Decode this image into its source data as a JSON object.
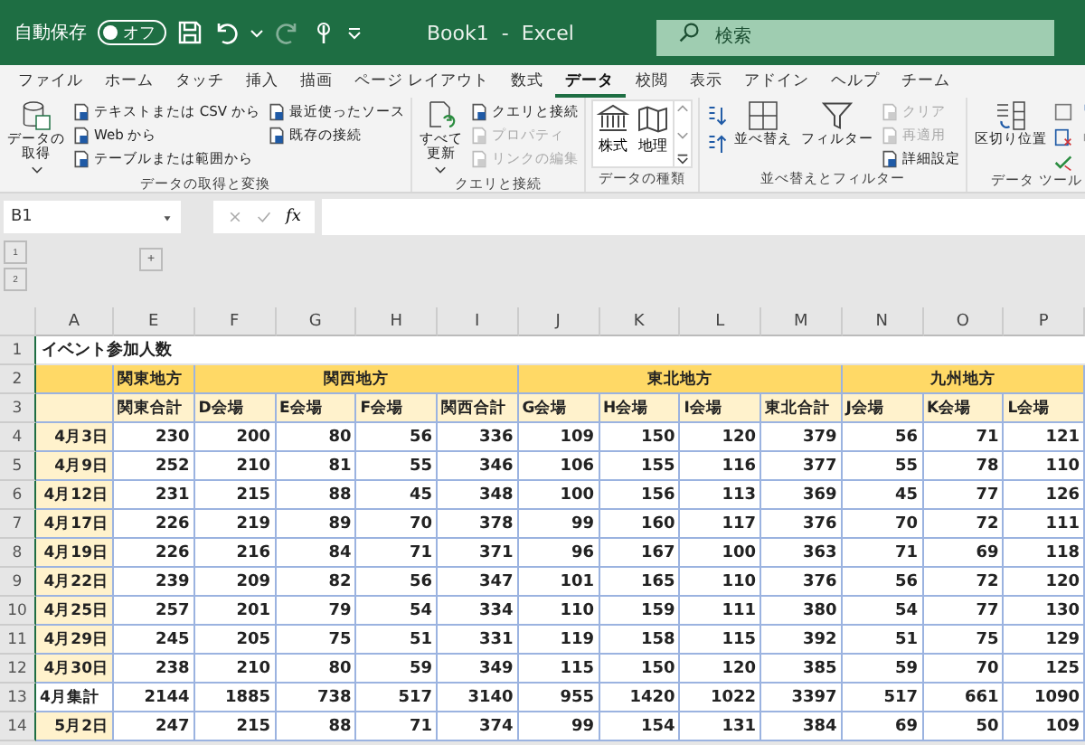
{
  "title_bar": {
    "autosave_label": "自動保存",
    "autosave_toggle": {
      "label": "オフ",
      "on": false
    },
    "title": "Book1  -  Excel",
    "search": {
      "placeholder": "検索"
    }
  },
  "tabs": [
    {
      "label": "ファイル",
      "selected": false
    },
    {
      "label": "ホーム",
      "selected": false
    },
    {
      "label": "タッチ",
      "selected": false
    },
    {
      "label": "挿入",
      "selected": false
    },
    {
      "label": "描画",
      "selected": false
    },
    {
      "label": "ページ レイアウト",
      "selected": false
    },
    {
      "label": "数式",
      "selected": false
    },
    {
      "label": "データ",
      "selected": true
    },
    {
      "label": "校閲",
      "selected": false
    },
    {
      "label": "表示",
      "selected": false
    },
    {
      "label": "アドイン",
      "selected": false
    },
    {
      "label": "ヘルプ",
      "selected": false
    },
    {
      "label": "チーム",
      "selected": false
    }
  ],
  "ribbon": [
    {
      "label": "データの取得と変換",
      "large": [
        {
          "lines": [
            "データの",
            "取得"
          ],
          "dropdown": true
        }
      ],
      "small": [
        {
          "label": "テキストまたは CSV から",
          "disabled": false
        },
        {
          "label": "Web から",
          "disabled": false
        },
        {
          "label": "テーブルまたは範囲から",
          "disabled": false
        },
        {
          "label": "最近使ったソース",
          "disabled": false
        },
        {
          "label": "既存の接続",
          "disabled": false
        }
      ]
    },
    {
      "label": "クエリと接続",
      "large": [
        {
          "lines": [
            "すべて",
            "更新"
          ],
          "dropdown": true
        }
      ],
      "small": [
        {
          "label": "クエリと接続",
          "disabled": false
        },
        {
          "label": "プロパティ",
          "disabled": true
        },
        {
          "label": "リンクの編集",
          "disabled": true
        }
      ]
    },
    {
      "label": "データの種類",
      "gallery": [
        {
          "label": "株式"
        },
        {
          "label": "地理"
        }
      ]
    },
    {
      "label": "並べ替えとフィルター",
      "large": [
        {
          "lines": [
            "並べ替え"
          ],
          "dropdown": false
        },
        {
          "lines": [
            "フィルター"
          ],
          "dropdown": false
        }
      ],
      "small": [
        {
          "label": "クリア",
          "disabled": true
        },
        {
          "label": "再適用",
          "disabled": true
        },
        {
          "label": "詳細設定",
          "disabled": false
        }
      ]
    },
    {
      "label": "データ ツール",
      "large": [
        {
          "lines": [
            "区切り位置"
          ],
          "dropdown": false
        }
      ]
    }
  ],
  "formula_bar": {
    "name_box": "B1",
    "fx": "fx"
  },
  "outline": {
    "levels": [
      "1",
      "2"
    ],
    "expand": "+"
  },
  "sheet": {
    "column_letters": [
      "A",
      "E",
      "F",
      "G",
      "H",
      "I",
      "J",
      "K",
      "L",
      "M",
      "N",
      "O",
      "P"
    ],
    "title": {
      "number": "1",
      "text": "イベント参加人数"
    },
    "group_row": {
      "number": "2",
      "groups": [
        {
          "label": "関東地方"
        },
        {
          "label": "関西地方"
        },
        {
          "label": "東北地方"
        },
        {
          "label": "九州地方"
        }
      ]
    },
    "header_row": {
      "number": "3",
      "headers": [
        "関東合計",
        "D会場",
        "E会場",
        "F会場",
        "関西合計",
        "G会場",
        "H会場",
        "I会場",
        "東北合計",
        "J会場",
        "K会場",
        "L会場"
      ]
    },
    "rows": [
      {
        "number": "4",
        "label": "4月3日",
        "kind": "day",
        "values": [
          "230",
          "200",
          "80",
          "56",
          "336",
          "109",
          "150",
          "120",
          "379",
          "56",
          "71",
          "121"
        ]
      },
      {
        "number": "5",
        "label": "4月9日",
        "kind": "day",
        "values": [
          "252",
          "210",
          "81",
          "55",
          "346",
          "106",
          "155",
          "116",
          "377",
          "55",
          "78",
          "110"
        ]
      },
      {
        "number": "6",
        "label": "4月12日",
        "kind": "day",
        "values": [
          "231",
          "215",
          "88",
          "45",
          "348",
          "100",
          "156",
          "113",
          "369",
          "45",
          "77",
          "126"
        ]
      },
      {
        "number": "7",
        "label": "4月17日",
        "kind": "day",
        "values": [
          "226",
          "219",
          "89",
          "70",
          "378",
          "99",
          "160",
          "117",
          "376",
          "70",
          "72",
          "111"
        ]
      },
      {
        "number": "8",
        "label": "4月19日",
        "kind": "day",
        "values": [
          "226",
          "216",
          "84",
          "71",
          "371",
          "96",
          "167",
          "100",
          "363",
          "71",
          "69",
          "118"
        ]
      },
      {
        "number": "9",
        "label": "4月22日",
        "kind": "day",
        "values": [
          "239",
          "209",
          "82",
          "56",
          "347",
          "101",
          "165",
          "110",
          "376",
          "56",
          "72",
          "120"
        ]
      },
      {
        "number": "10",
        "label": "4月25日",
        "kind": "day",
        "values": [
          "257",
          "201",
          "79",
          "54",
          "334",
          "110",
          "159",
          "111",
          "380",
          "54",
          "77",
          "130"
        ]
      },
      {
        "number": "11",
        "label": "4月29日",
        "kind": "day",
        "values": [
          "245",
          "205",
          "75",
          "51",
          "331",
          "119",
          "158",
          "115",
          "392",
          "51",
          "75",
          "129"
        ]
      },
      {
        "number": "12",
        "label": "4月30日",
        "kind": "day",
        "values": [
          "238",
          "210",
          "80",
          "59",
          "349",
          "115",
          "150",
          "120",
          "385",
          "59",
          "70",
          "125"
        ]
      },
      {
        "number": "13",
        "label": "4月集計",
        "kind": "total",
        "values": [
          "2144",
          "1885",
          "738",
          "517",
          "3140",
          "955",
          "1420",
          "1022",
          "3397",
          "517",
          "661",
          "1090"
        ]
      },
      {
        "number": "14",
        "label": "5月2日",
        "kind": "day",
        "values": [
          "247",
          "215",
          "88",
          "71",
          "374",
          "99",
          "154",
          "131",
          "384",
          "69",
          "50",
          "109"
        ]
      }
    ]
  }
}
